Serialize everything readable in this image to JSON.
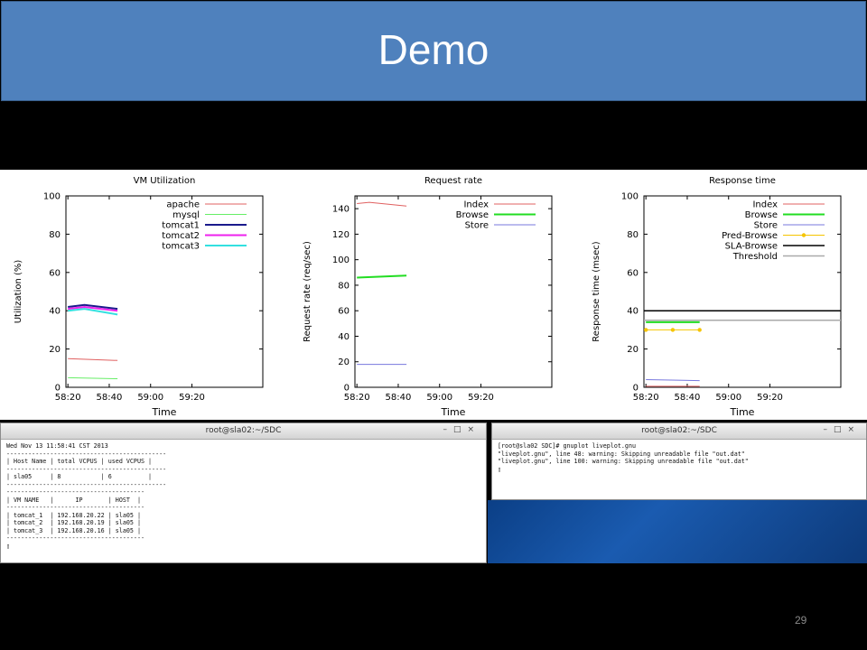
{
  "slide": {
    "title": "Demo",
    "page_number": "29"
  },
  "colors": {
    "title_bg": "#4f81bd",
    "apache": "#e06060",
    "mysql": "#66ee66",
    "tomcat1": "#1a1a8c",
    "tomcat2": "#ee22ee",
    "tomcat3": "#33e0e0",
    "index": "#e06060",
    "browse": "#22dd22",
    "store": "#7777dd",
    "pred": "#f5c400",
    "sla": "#000000",
    "threshold": "#aaaaaa"
  },
  "chart_data": [
    {
      "type": "line",
      "title": "VM Utilization",
      "xlabel": "Time",
      "ylabel": "Utilization (%)",
      "xlim": [
        0,
        5
      ],
      "ylim": [
        0,
        100
      ],
      "xticks": [
        "58:20",
        "58:40",
        "59:00",
        "59:20"
      ],
      "yticks": [
        0,
        20,
        40,
        60,
        80,
        100
      ],
      "series": [
        {
          "name": "apache",
          "color": "#e06060",
          "width": 1,
          "points": [
            [
              0,
              15
            ],
            [
              1.2,
              14
            ]
          ]
        },
        {
          "name": "mysql",
          "color": "#66ee66",
          "width": 1,
          "points": [
            [
              0,
              5
            ],
            [
              1.2,
              4.5
            ]
          ]
        },
        {
          "name": "tomcat1",
          "color": "#1a1a8c",
          "width": 2,
          "points": [
            [
              0,
              42
            ],
            [
              0.4,
              43
            ],
            [
              1.2,
              41
            ]
          ]
        },
        {
          "name": "tomcat2",
          "color": "#ee22ee",
          "width": 2,
          "points": [
            [
              0,
              41
            ],
            [
              0.4,
              42
            ],
            [
              1.2,
              40
            ]
          ]
        },
        {
          "name": "tomcat3",
          "color": "#33e0e0",
          "width": 2,
          "points": [
            [
              0,
              40
            ],
            [
              0.4,
              41
            ],
            [
              1.2,
              38
            ]
          ]
        }
      ]
    },
    {
      "type": "line",
      "title": "Request rate",
      "xlabel": "Time",
      "ylabel": "Request rate (req/sec)",
      "xlim": [
        0,
        5
      ],
      "ylim": [
        0,
        150
      ],
      "xticks": [
        "58:20",
        "58:40",
        "59:00",
        "59:20"
      ],
      "yticks": [
        0,
        20,
        40,
        60,
        80,
        100,
        120,
        140
      ],
      "series": [
        {
          "name": "Index",
          "color": "#e06060",
          "width": 1,
          "points": [
            [
              0,
              144
            ],
            [
              0.3,
              145
            ],
            [
              1.2,
              142
            ]
          ]
        },
        {
          "name": "Browse",
          "color": "#22dd22",
          "width": 2,
          "points": [
            [
              0,
              86
            ],
            [
              0.4,
              86.5
            ],
            [
              1.2,
              87.5
            ]
          ]
        },
        {
          "name": "Store",
          "color": "#7777dd",
          "width": 1,
          "points": [
            [
              0,
              18
            ],
            [
              1.2,
              18
            ]
          ]
        }
      ]
    },
    {
      "type": "line",
      "title": "Response time",
      "xlabel": "Time",
      "ylabel": "Response time (msec)",
      "xlim": [
        0,
        5
      ],
      "ylim": [
        0,
        100
      ],
      "xticks": [
        "58:20",
        "58:40",
        "59:00",
        "59:20"
      ],
      "yticks": [
        0,
        20,
        40,
        60,
        80,
        100
      ],
      "series": [
        {
          "name": "Index",
          "color": "#e06060",
          "width": 1,
          "points": [
            [
              0,
              0.5
            ],
            [
              1.3,
              0.5
            ]
          ]
        },
        {
          "name": "Browse",
          "color": "#22dd22",
          "width": 2,
          "points": [
            [
              0,
              34
            ],
            [
              1.3,
              34
            ]
          ]
        },
        {
          "name": "Store",
          "color": "#7777dd",
          "width": 1,
          "points": [
            [
              0,
              4
            ],
            [
              1.3,
              3.5
            ]
          ]
        },
        {
          "name": "Pred-Browse",
          "color": "#f5c400",
          "width": 1,
          "marker": true,
          "points": [
            [
              0,
              30
            ],
            [
              0.65,
              30
            ],
            [
              1.3,
              30
            ]
          ]
        },
        {
          "name": "SLA-Browse",
          "color": "#000000",
          "width": 1.5,
          "points": [
            [
              0,
              40
            ],
            [
              5,
              40
            ]
          ]
        },
        {
          "name": "Threshold",
          "color": "#aaaaaa",
          "width": 1.5,
          "points": [
            [
              0,
              35
            ],
            [
              5,
              35
            ]
          ]
        }
      ]
    }
  ],
  "terminal1": {
    "title": "root@sla02:~/SDC",
    "lines": [
      "Wed Nov 13 11:58:41 CST 2013",
      "--------------------------------------------",
      "| Host Name | total VCPUS | used VCPUS |",
      "--------------------------------------------",
      "| sla05     | 8           | 6          |",
      "--------------------------------------------",
      "--------------------------------------",
      "| VM NAME   |      IP       | HOST  |",
      "--------------------------------------",
      "| tomcat_1  | 192.168.20.22 | sla05 |",
      "| tomcat_2  | 192.168.20.19 | sla05 |",
      "| tomcat_3  | 192.168.20.16 | sla05 |",
      "--------------------------------------",
      "▯"
    ]
  },
  "terminal2": {
    "title": "root@sla02:~/SDC",
    "lines": [
      "[root@sla02 SDC]# gnuplot liveplot.gnu",
      "\"liveplot.gnu\", line 48: warning: Skipping unreadable file \"out.dat\"",
      "\"liveplot.gnu\", line 100: warning: Skipping unreadable file \"out.dat\"",
      "▯"
    ]
  },
  "window_controls": "–□×"
}
